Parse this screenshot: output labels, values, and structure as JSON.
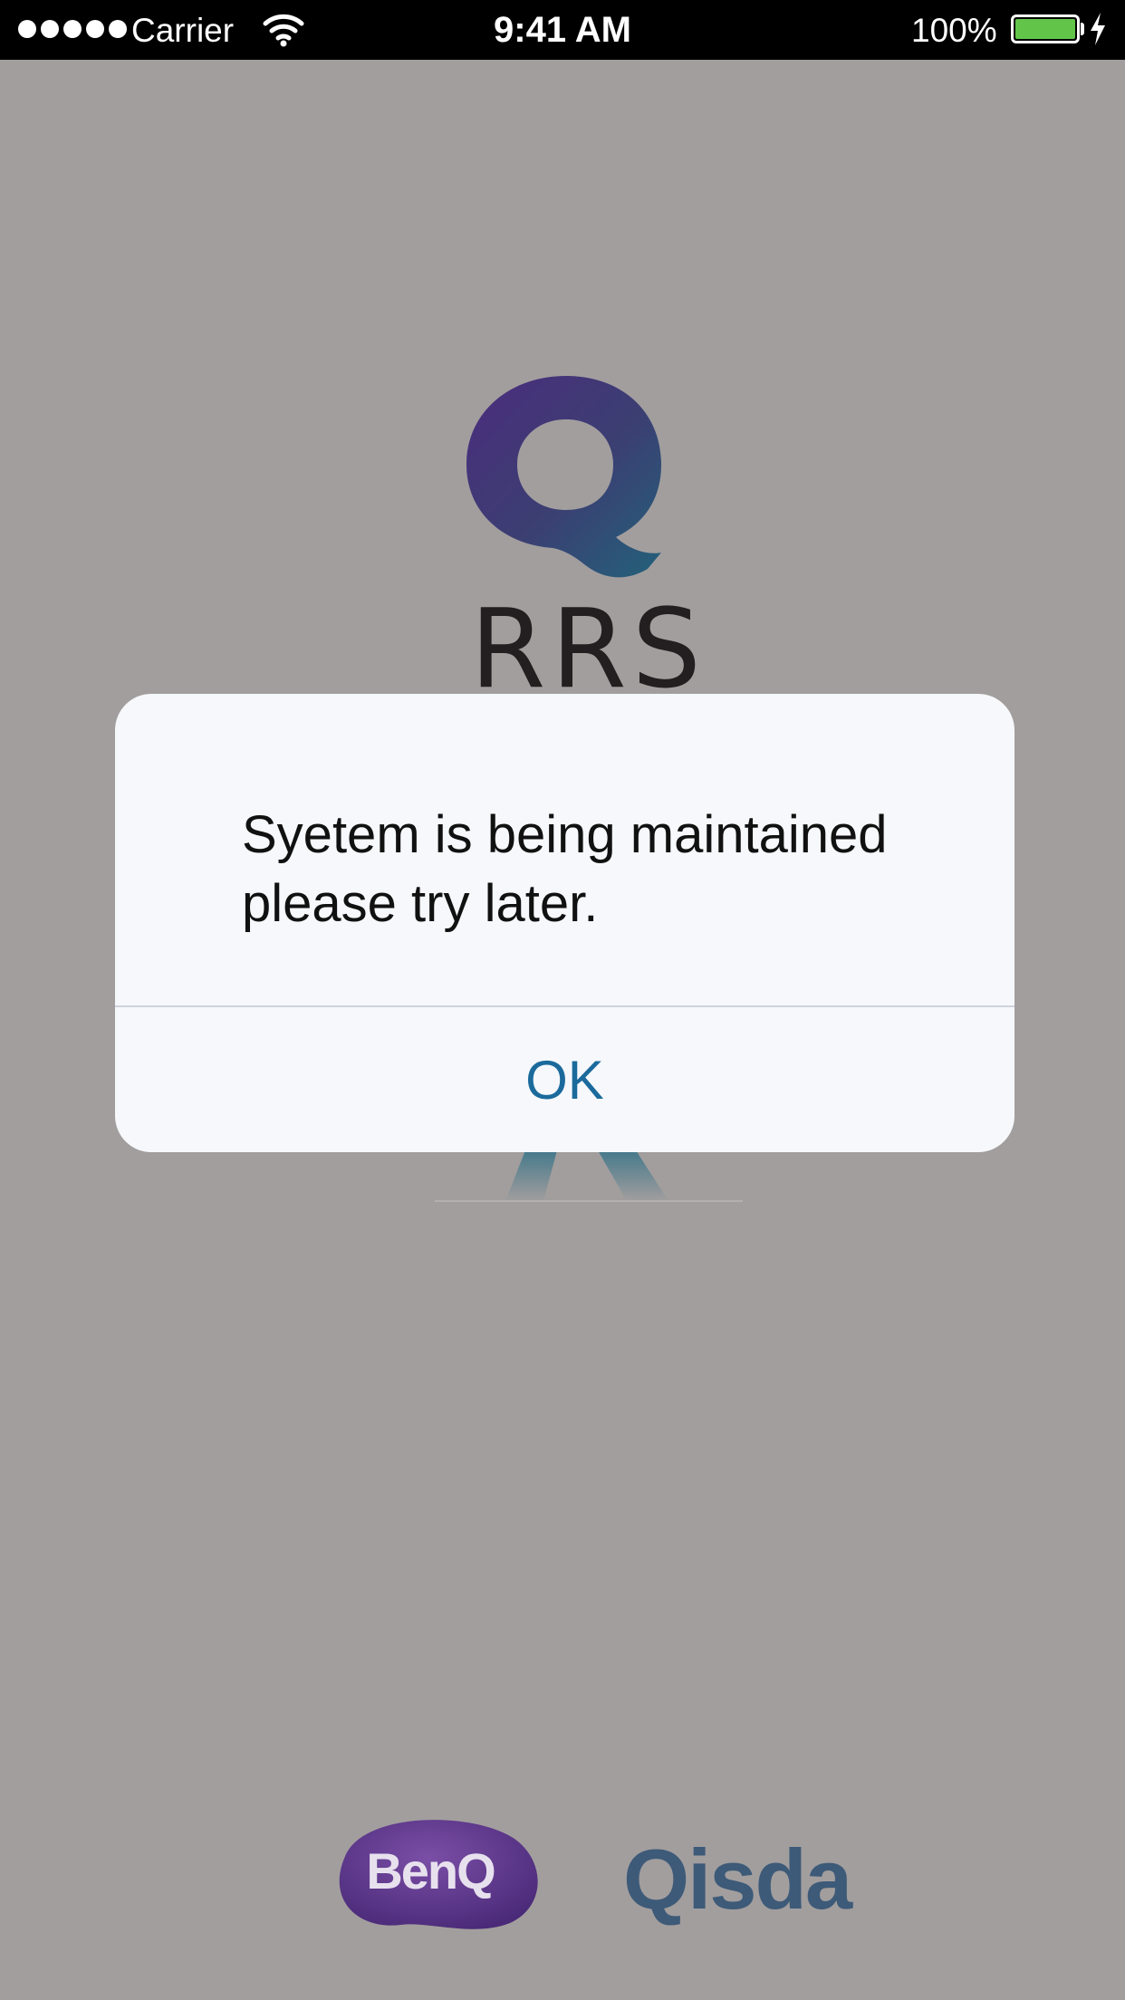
{
  "status_bar": {
    "carrier": "Carrier",
    "time": "9:41 AM",
    "battery_percent": "100%",
    "battery_level": 1.0,
    "battery_color": "#62c54a"
  },
  "splash": {
    "logo_text": "RRS",
    "footer_logos": {
      "benq": "BenQ",
      "qisda": "Qisda"
    }
  },
  "alert": {
    "line1": "Syetem is being maintained",
    "line2": "please try later.",
    "ok_label": "OK",
    "ok_color": "#1b6a9c"
  }
}
